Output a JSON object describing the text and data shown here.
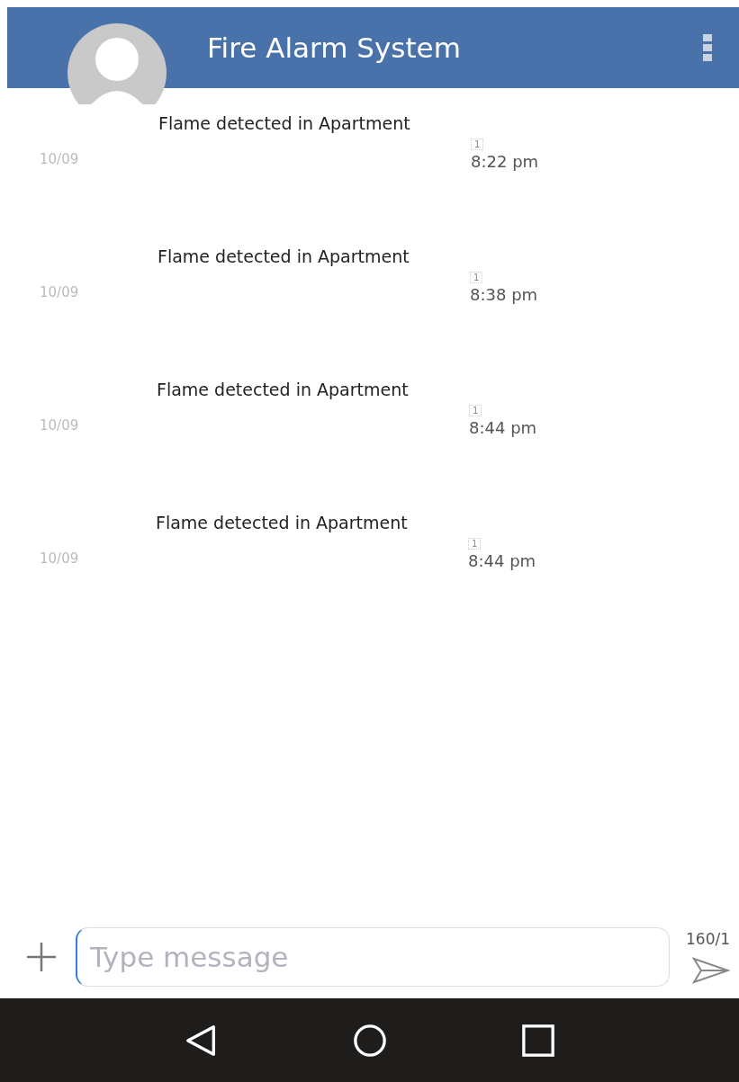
{
  "app_bar": {
    "title": "Fire Alarm System"
  },
  "messages": [
    {
      "text": "Flame detected in Apartment",
      "date": "10/09",
      "sim": "1",
      "time": "8:22 pm"
    },
    {
      "text": "Flame detected in Apartment",
      "date": "10/09",
      "sim": "1",
      "time": "8:38 pm"
    },
    {
      "text": "Flame detected in Apartment",
      "date": "10/09",
      "sim": "1",
      "time": "8:44 pm"
    },
    {
      "text": "Flame detected in Apartment",
      "date": "10/09",
      "sim": "1",
      "time": "8:44 pm"
    }
  ],
  "composer": {
    "placeholder": "Type message",
    "counter": "160/1"
  }
}
